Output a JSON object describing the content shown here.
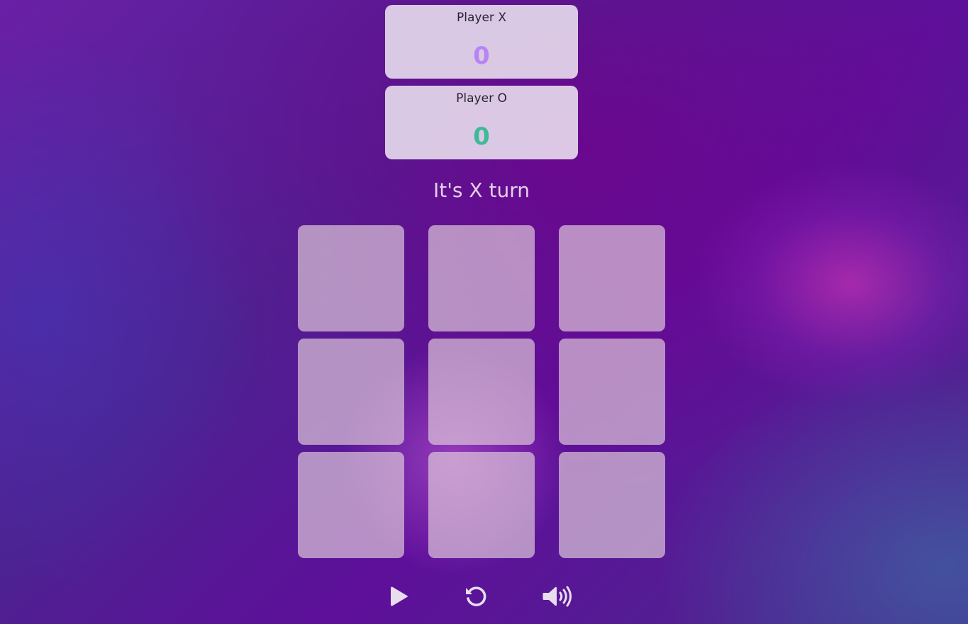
{
  "scoreboard": {
    "player_x": {
      "label": "Player X",
      "score": "0",
      "color": "#b586f2"
    },
    "player_o": {
      "label": "Player O",
      "score": "0",
      "color": "#3fba96"
    }
  },
  "status": {
    "turn_text": "It's X turn"
  },
  "board": {
    "cells": [
      "",
      "",
      "",
      "",
      "",
      "",
      "",
      "",
      ""
    ]
  },
  "controls": {
    "play": {
      "icon": "play-icon"
    },
    "restart": {
      "icon": "restart-icon"
    },
    "sound": {
      "icon": "volume-icon"
    }
  },
  "colors": {
    "icon": "#e8dced",
    "card_bg": "#ece2f0",
    "cell_bg": "#e1cddc"
  }
}
